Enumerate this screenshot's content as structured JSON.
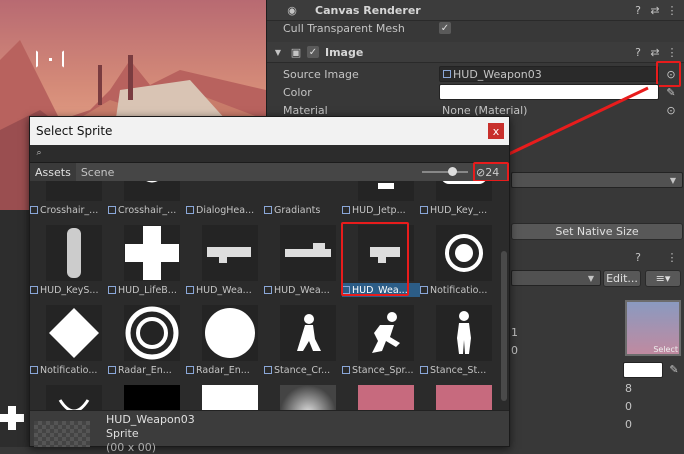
{
  "inspector": {
    "canvas_renderer": {
      "title": "Canvas Renderer",
      "cull_label": "Cull Transparent Mesh",
      "cull_checked": "✓"
    },
    "image": {
      "title": "Image",
      "enabled": "✓",
      "source_image_label": "Source Image",
      "source_image_value": "HUD_Weapon03",
      "color_label": "Color",
      "material_label": "Material",
      "material_value": "None (Material)"
    },
    "set_native_size": "Set Native Size",
    "edit_button": "Edit...",
    "numbers": [
      "1",
      "0",
      "8",
      "0",
      "0"
    ],
    "select_label": "Select"
  },
  "dialog": {
    "title": "Select Sprite",
    "close": "x",
    "tabs": [
      "Assets",
      "Scene"
    ],
    "hidden_count": "24",
    "items": [
      {
        "label": "Crosshair_..."
      },
      {
        "label": "Crosshair_..."
      },
      {
        "label": "DialogHea..."
      },
      {
        "label": "Gradiants"
      },
      {
        "label": "HUD_Jetp..."
      },
      {
        "label": "HUD_Key_..."
      },
      {
        "label": "HUD_KeyS..."
      },
      {
        "label": "HUD_LifeB..."
      },
      {
        "label": "HUD_Wea..."
      },
      {
        "label": "HUD_Wea..."
      },
      {
        "label": "HUD_Wea...",
        "selected": true
      },
      {
        "label": "Notificatio..."
      },
      {
        "label": "Notificatio..."
      },
      {
        "label": "Radar_En..."
      },
      {
        "label": "Radar_En..."
      },
      {
        "label": "Stance_Cr..."
      },
      {
        "label": "Stance_Spr..."
      },
      {
        "label": "Stance_St..."
      }
    ],
    "preview": {
      "name": "HUD_Weapon03",
      "type": "Sprite",
      "size": "(00 x 00)"
    }
  }
}
